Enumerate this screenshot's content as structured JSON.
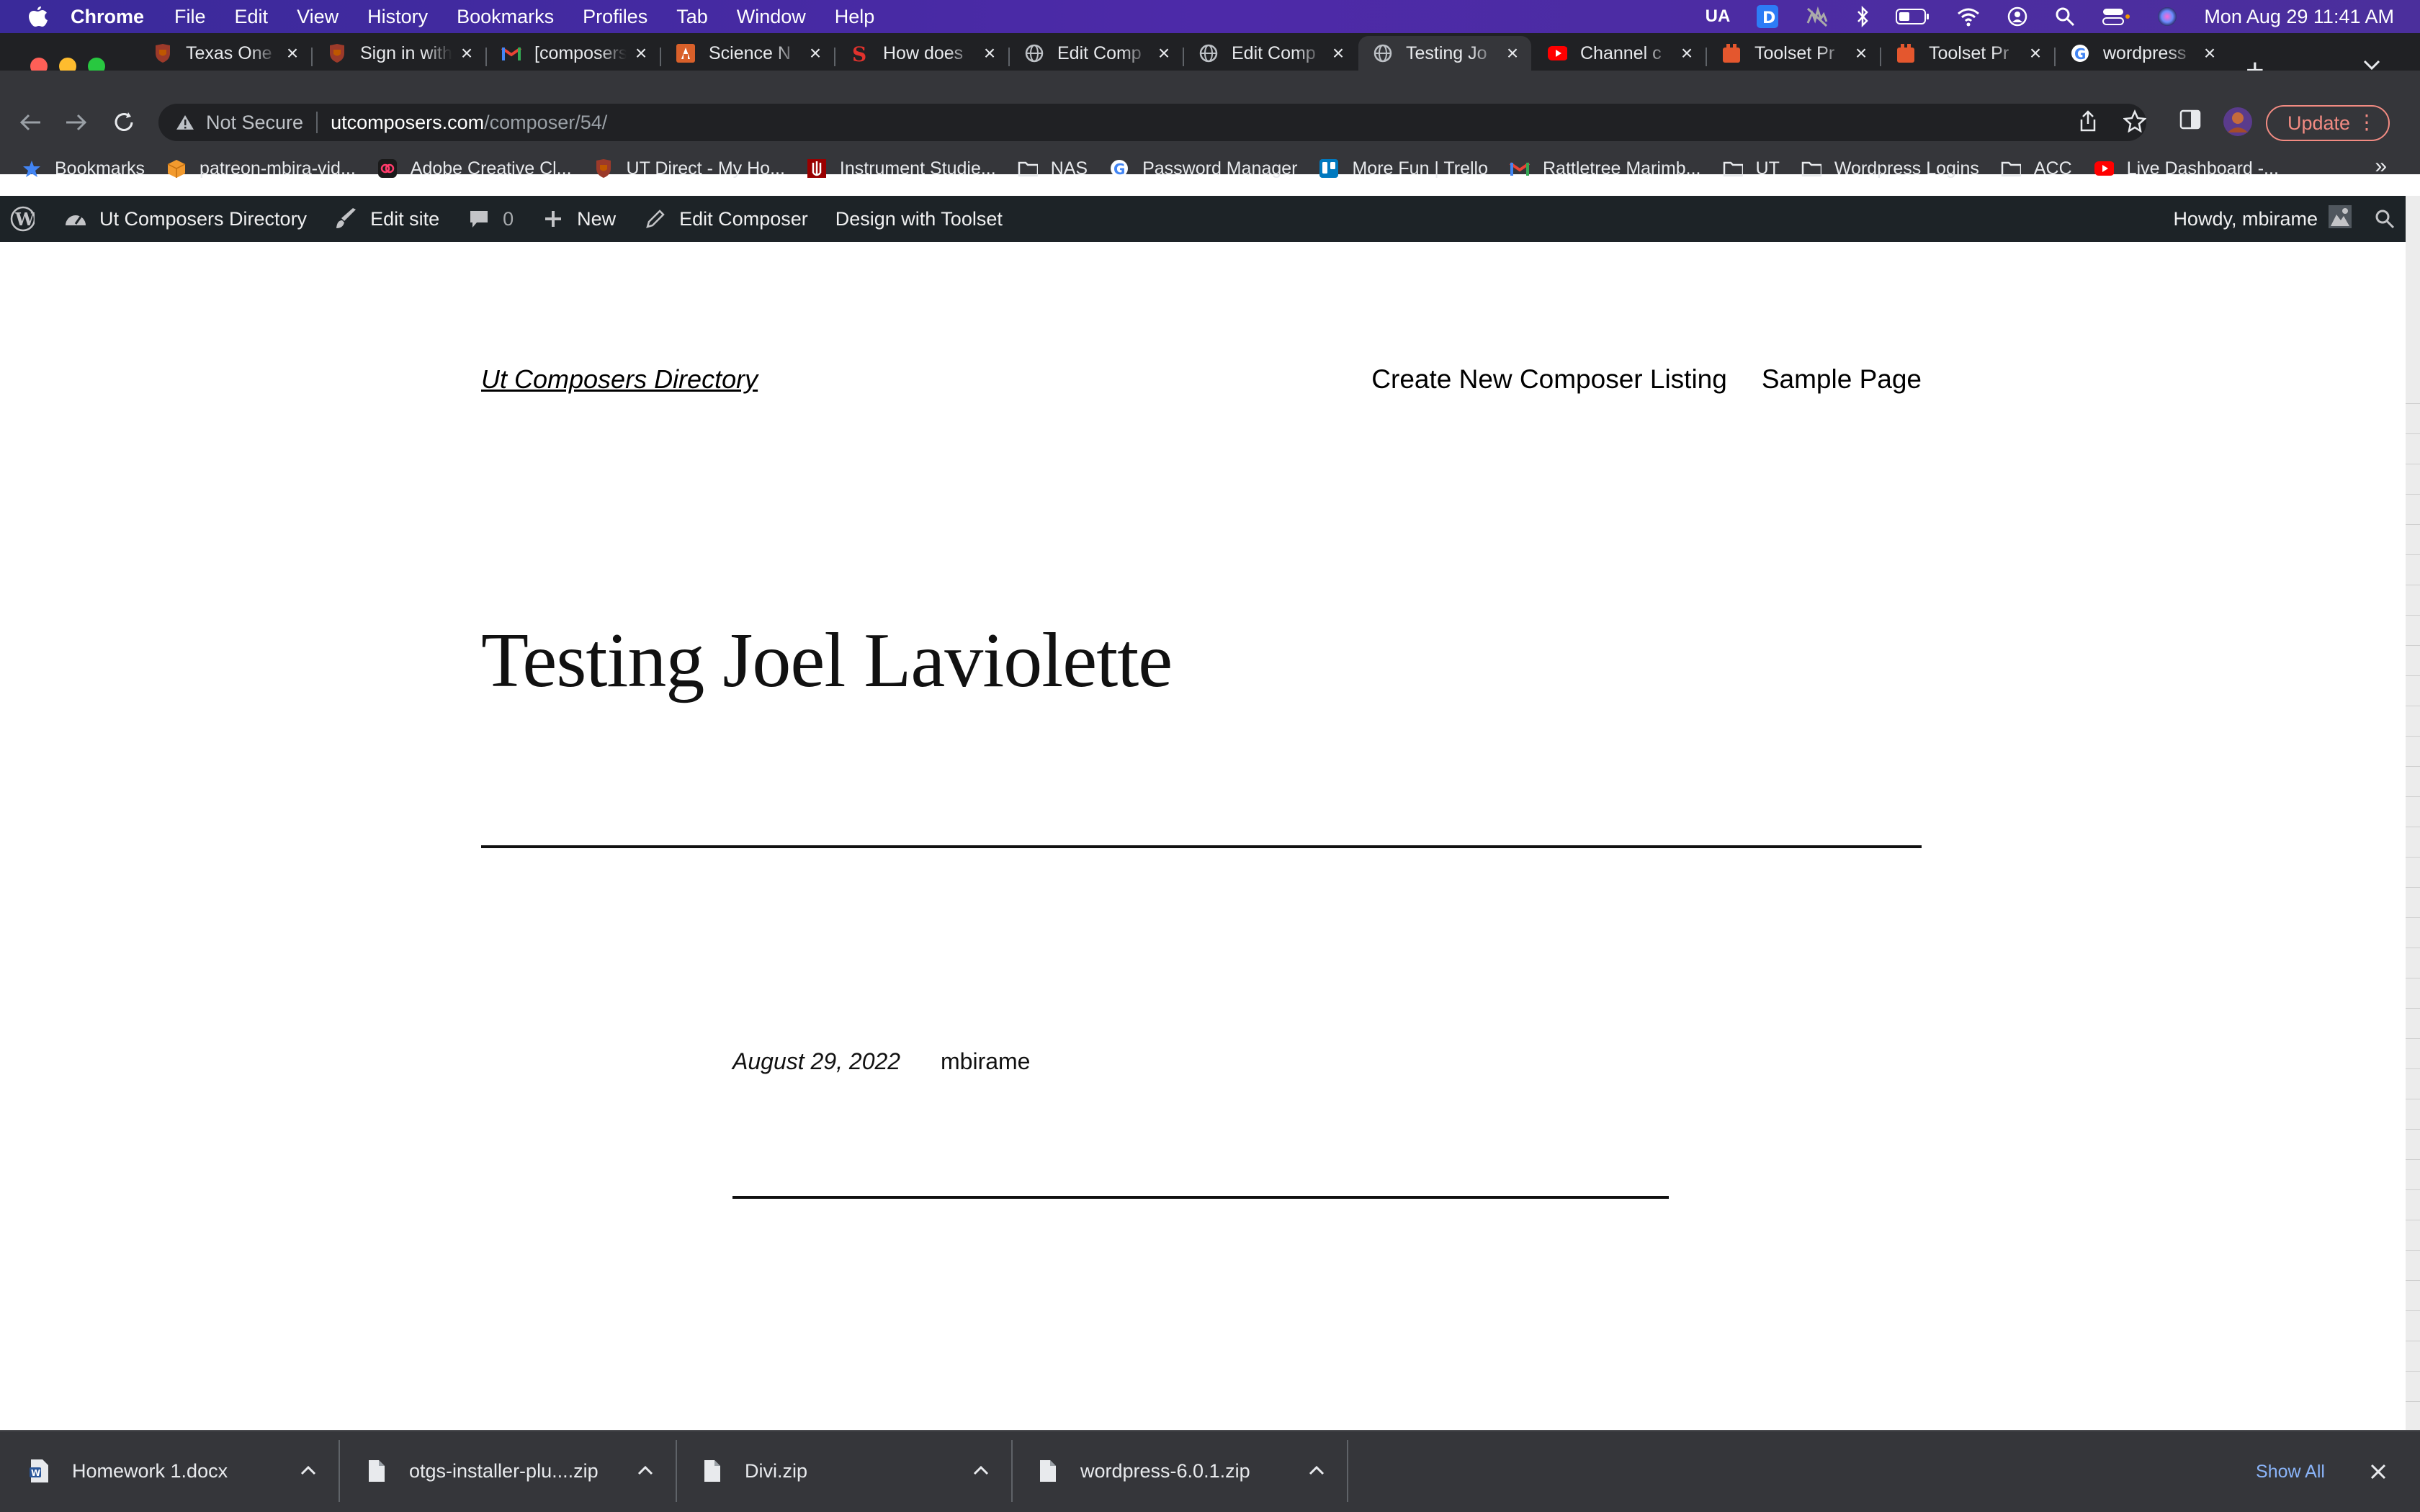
{
  "menubar": {
    "app": "Chrome",
    "items": [
      "File",
      "Edit",
      "View",
      "History",
      "Bookmarks",
      "Profiles",
      "Tab",
      "Window",
      "Help"
    ],
    "status_text": "UA",
    "clock": "Mon Aug 29  11:41 AM"
  },
  "tabs": [
    {
      "title": "Texas One",
      "icon": "texas-shield-icon"
    },
    {
      "title": "Sign in with",
      "icon": "texas-shield-icon"
    },
    {
      "title": "[composers",
      "icon": "gmail-icon"
    },
    {
      "title": "Science N",
      "icon": "science-icon"
    },
    {
      "title": "How does",
      "icon": "s-logo-icon"
    },
    {
      "title": "Edit Comp",
      "icon": "globe-icon"
    },
    {
      "title": "Edit Comp",
      "icon": "globe-icon"
    },
    {
      "title": "Testing Jo",
      "icon": "globe-icon",
      "active": true
    },
    {
      "title": "Channel c",
      "icon": "youtube-icon"
    },
    {
      "title": "Toolset Pr",
      "icon": "toolset-icon"
    },
    {
      "title": "Toolset Pr",
      "icon": "toolset-icon"
    },
    {
      "title": "wordpress",
      "icon": "google-icon"
    }
  ],
  "address": {
    "security": "Not Secure",
    "host": "utcomposers.com",
    "path": "/composer/54/"
  },
  "update_label": "Update",
  "bookmarks": [
    {
      "label": "Bookmarks",
      "icon": "star-icon"
    },
    {
      "label": "patreon-mbira-vid...",
      "icon": "box-icon"
    },
    {
      "label": "Adobe Creative Cl...",
      "icon": "adobe-cc-icon"
    },
    {
      "label": "UT Direct - My Ho...",
      "icon": "texas-shield-icon"
    },
    {
      "label": "Instrument Studie...",
      "icon": "iu-logo-icon"
    },
    {
      "label": "NAS",
      "icon": "folder-icon"
    },
    {
      "label": "Password Manager",
      "icon": "google-icon"
    },
    {
      "label": "More Fun | Trello",
      "icon": "trello-icon"
    },
    {
      "label": "Rattletree Marimb...",
      "icon": "gmail-icon"
    },
    {
      "label": "UT",
      "icon": "folder-icon"
    },
    {
      "label": "Wordpress Logins",
      "icon": "folder-icon"
    },
    {
      "label": "ACC",
      "icon": "folder-icon"
    },
    {
      "label": "Live Dashboard -...",
      "icon": "youtube-icon"
    }
  ],
  "adminbar": {
    "site_name": "Ut Composers Directory",
    "edit_site": "Edit site",
    "comments_count": "0",
    "new_label": "New",
    "edit_composer": "Edit Composer",
    "design_toolset": "Design with Toolset",
    "howdy": "Howdy, mbirame"
  },
  "site": {
    "title": "Ut Composers Directory",
    "nav": [
      "Create New Composer Listing",
      "Sample Page"
    ]
  },
  "post": {
    "title": "Testing Joel Laviolette",
    "date": "August 29, 2022",
    "author": "mbirame"
  },
  "downloads": [
    {
      "name": "Homework 1.docx",
      "icon": "word-doc-icon"
    },
    {
      "name": "otgs-installer-plu....zip",
      "icon": "file-icon"
    },
    {
      "name": "Divi.zip",
      "icon": "file-icon"
    },
    {
      "name": "wordpress-6.0.1.zip",
      "icon": "file-icon"
    }
  ],
  "show_all": "Show All",
  "colors": {
    "menubar": "#4a2aa6",
    "chrome_dark": "#35363a",
    "wp_admin": "#1d2327",
    "update_accent": "#f28b82",
    "link_blue": "#8ab4f8"
  }
}
